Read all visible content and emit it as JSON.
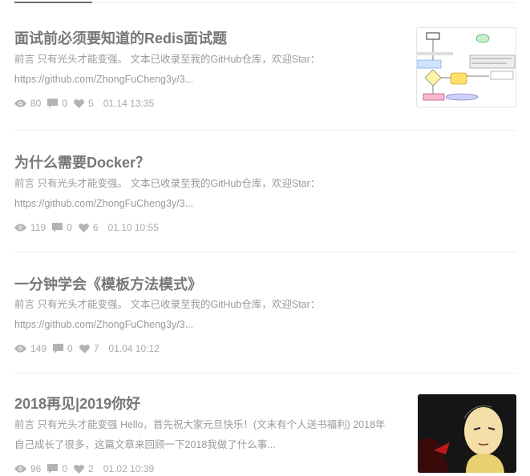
{
  "articles": [
    {
      "title": "面试前必须要知道的Redis面试题",
      "summary_line1": "前言 只有光头才能变强。 文本已收录至我的GitHub仓库，欢迎Star：",
      "summary_line2": "https://github.com/ZhongFuCheng3y/3...",
      "views": "80",
      "comments": "0",
      "likes": "5",
      "date": "01.14 13:35",
      "thumbnail": "flowchart-diagram"
    },
    {
      "title": "为什么需要Docker？",
      "summary_line1": "前言 只有光头才能变强。 文本已收录至我的GitHub仓库，欢迎Star：",
      "summary_line2": "https://github.com/ZhongFuCheng3y/3...",
      "views": "119",
      "comments": "0",
      "likes": "6",
      "date": "01.10 10:55"
    },
    {
      "title": "一分钟学会《模板方法模式》",
      "summary_line1": "前言 只有光头才能变强。 文本已收录至我的GitHub仓库，欢迎Star：",
      "summary_line2": "https://github.com/ZhongFuCheng3y/3...",
      "views": "149",
      "comments": "0",
      "likes": "7",
      "date": "01.04 10:12"
    },
    {
      "title": "2018再见|2019你好",
      "summary_line1": "前言 只有光头才能变强 Hello，首先祝大家元旦快乐！(文末有个人送书福利) 2018年",
      "summary_line2": "自己成长了很多，这篇文章来回顾一下2018我做了什么事...",
      "views": "96",
      "comments": "0",
      "likes": "2",
      "date": "01.02 10:39",
      "thumbnail": "anime-bald-hero"
    }
  ],
  "icons": {
    "views": "eye-icon",
    "comments": "comment-icon",
    "likes": "heart-icon"
  },
  "colors": {
    "title": "#777777",
    "summary": "#9a9a9a",
    "meta": "#aaaaaa",
    "divider": "#ededed"
  }
}
